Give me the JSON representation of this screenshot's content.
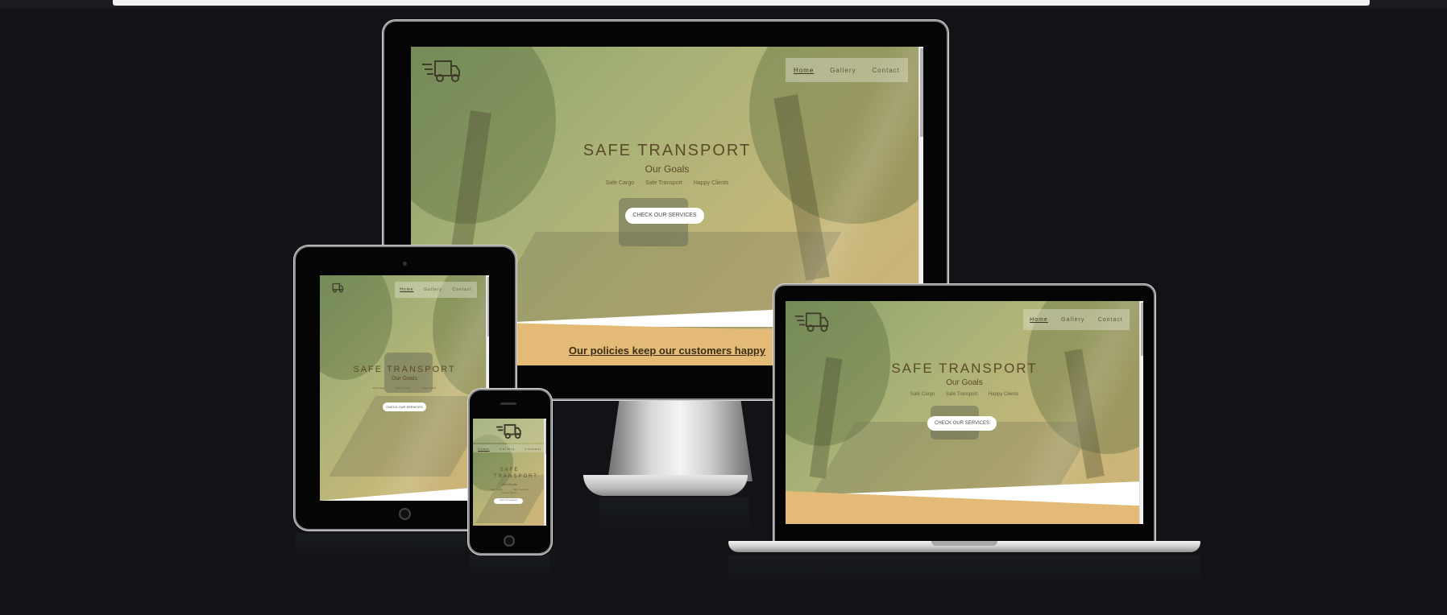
{
  "site": {
    "title": "SAFE TRANSPORT",
    "subtitle": "Our Goals",
    "goals": [
      "Safe Cargo",
      "Safe Transport",
      "Happy Clients"
    ],
    "cta": "CHECK OUR SERVICES",
    "nav": [
      "Home",
      "Gallery",
      "Contact"
    ],
    "active_nav": "Home",
    "policies_heading": "Our policies keep our customers happy"
  },
  "colors": {
    "page_background": "#111317",
    "accent_tan": "#e3bb77",
    "text_brown": "#5a4a2a"
  },
  "icons": [
    "truck-logo-icon"
  ]
}
